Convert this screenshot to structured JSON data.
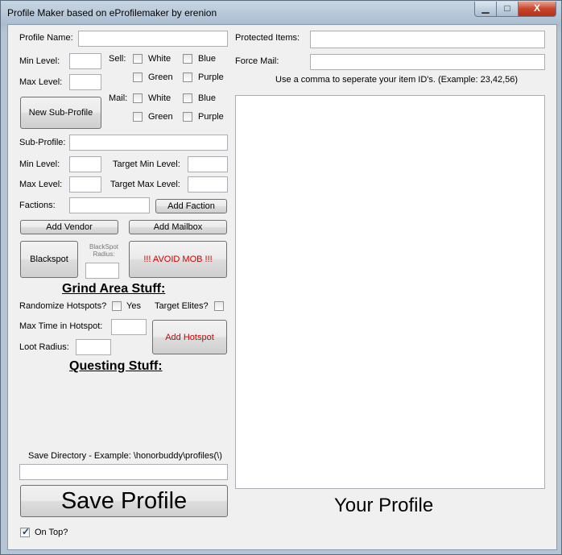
{
  "window": {
    "title": "Profile Maker based on eProfilemaker by erenion",
    "min_glyph": "▁",
    "max_glyph": "□",
    "close_glyph": "X"
  },
  "profile": {
    "name_label": "Profile Name:",
    "min_level_label": "Min Level:",
    "max_level_label": "Max Level:",
    "sell_label": "Sell:",
    "mail_label": "Mail:",
    "white": "White",
    "blue": "Blue",
    "green": "Green",
    "purple": "Purple",
    "new_subprofile": "New Sub-Profile"
  },
  "subprofile": {
    "label": "Sub-Profile:",
    "min_level_label": "Min Level:",
    "max_level_label": "Max Level:",
    "target_min_label": "Target Min Level:",
    "target_max_label": "Target Max Level:",
    "factions_label": "Factions:",
    "add_faction": "Add Faction",
    "add_vendor": "Add Vendor",
    "add_mailbox": "Add Mailbox",
    "blackspot": "Blackspot",
    "blackspot_radius": "BlackSpot Radius:",
    "avoid_mob": "!!! AVOID MOB !!!"
  },
  "grind": {
    "heading": "Grind Area Stuff:",
    "randomize_label": "Randomize Hotspots?",
    "yes": "Yes",
    "target_elites": "Target Elites?",
    "max_time_label": "Max Time in Hotspot:",
    "loot_radius_label": "Loot Radius:",
    "add_hotspot": "Add Hotspot"
  },
  "questing": {
    "heading": "Questing Stuff:"
  },
  "save": {
    "directory_label": "Save Directory - Example: \\honorbuddy\\profiles(\\)",
    "save_button": "Save Profile",
    "on_top": "On Top?"
  },
  "right": {
    "protected_label": "Protected Items:",
    "force_mail_label": "Force Mail:",
    "hint": "Use a comma to seperate your item ID's. (Example: 23,42,56)",
    "your_profile": "Your Profile"
  }
}
